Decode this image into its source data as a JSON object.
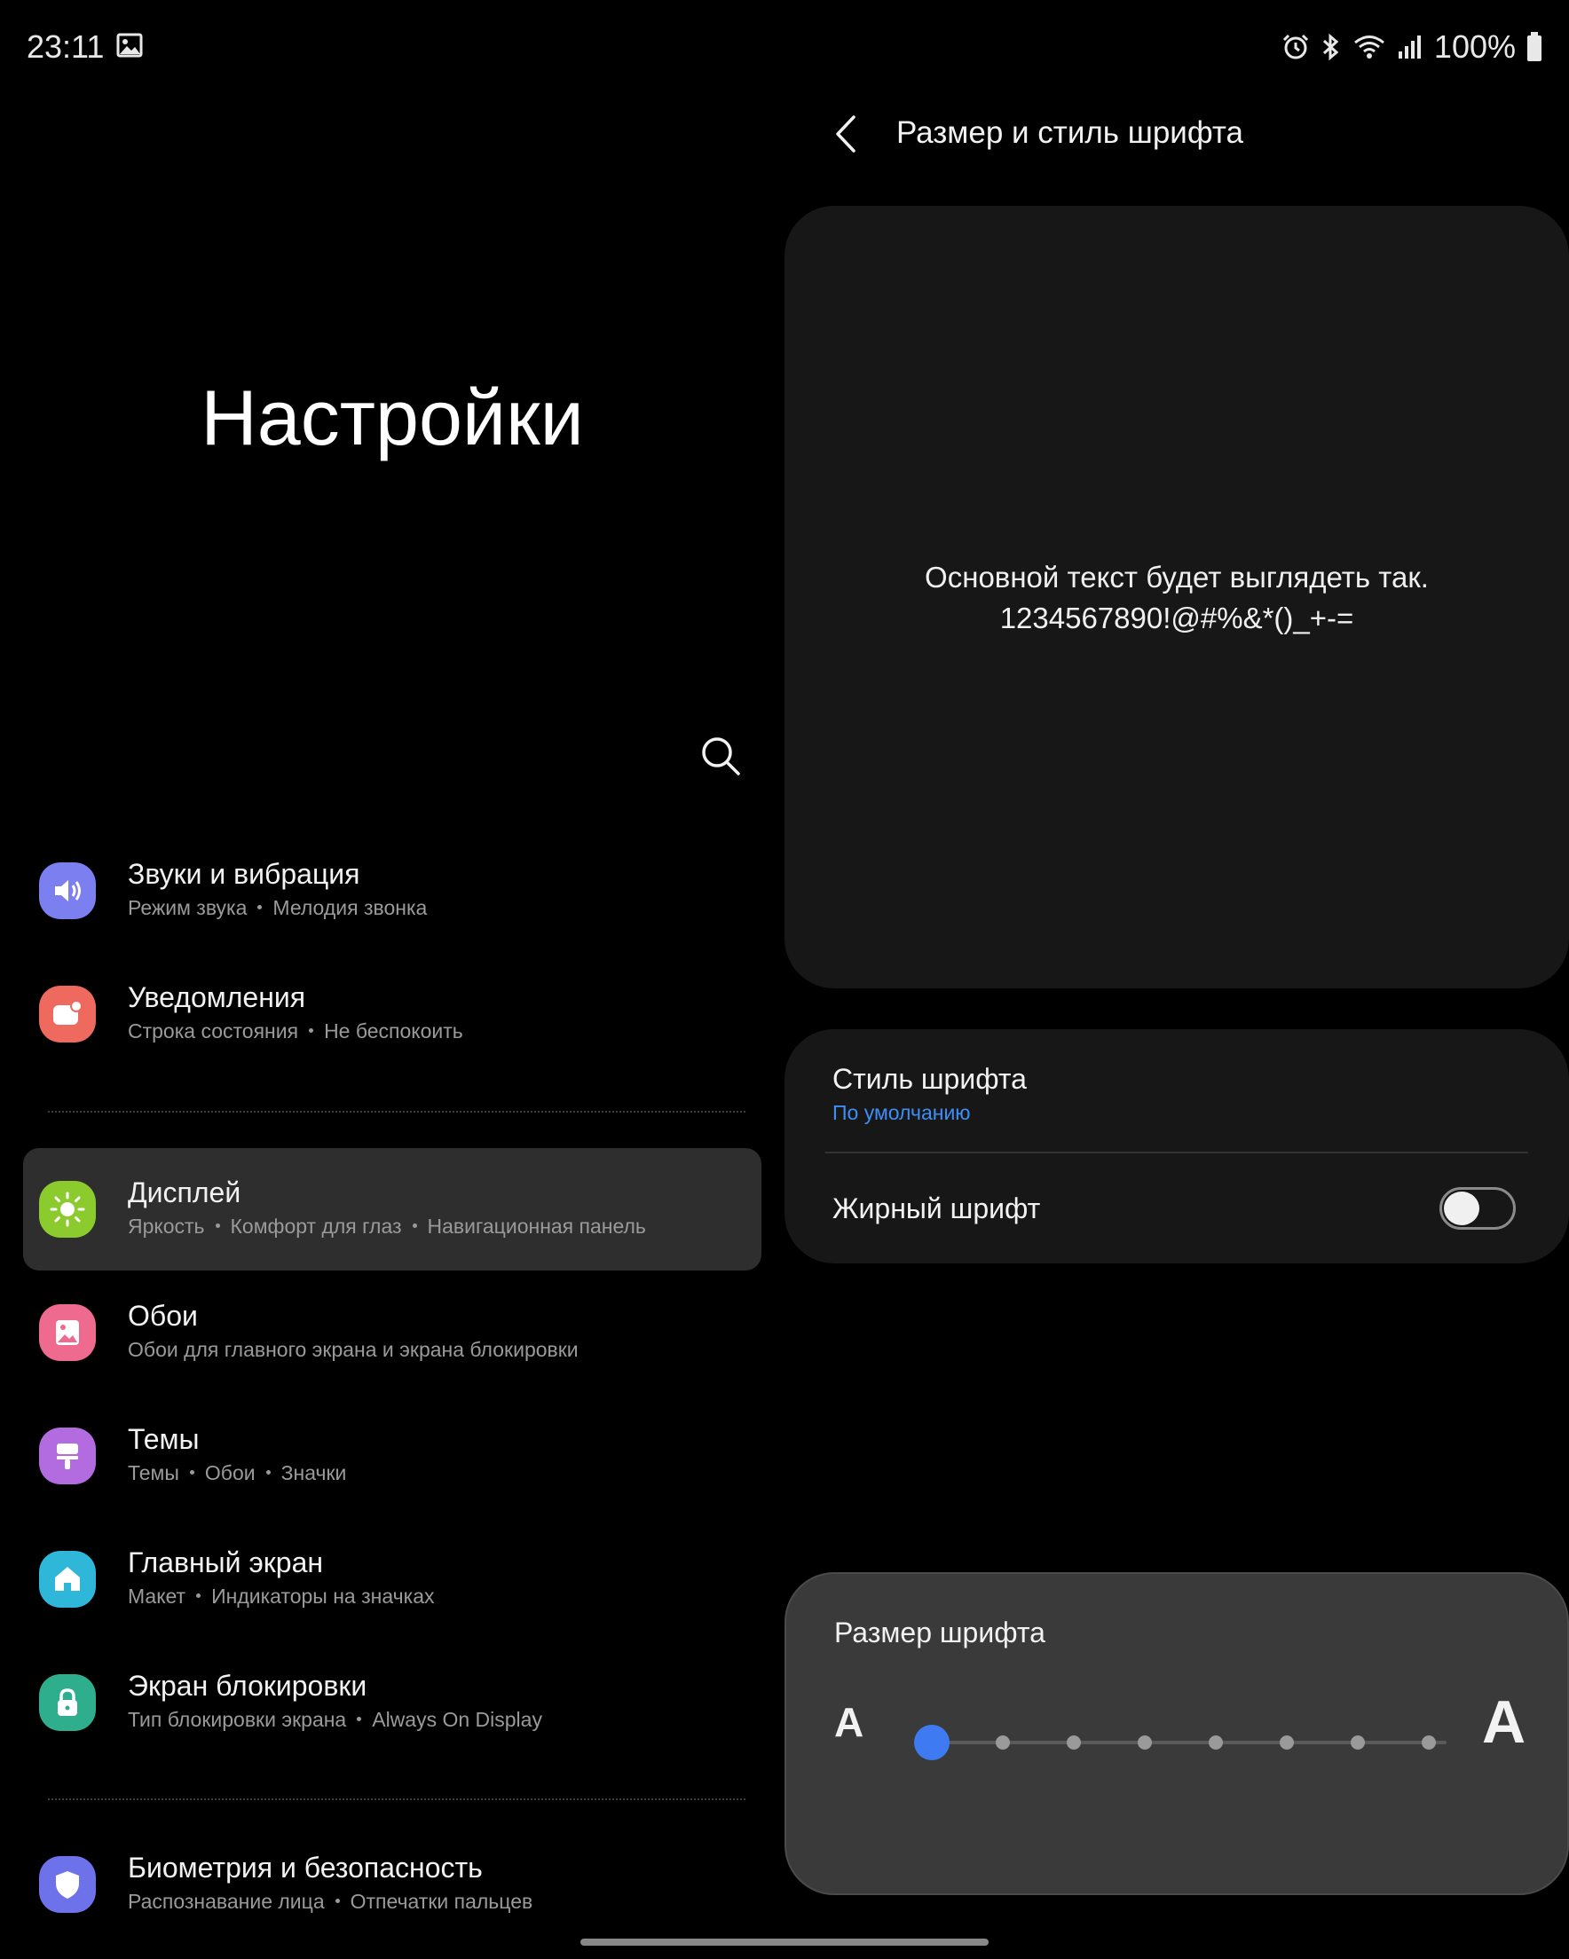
{
  "status": {
    "time": "23:11",
    "battery": "100%"
  },
  "left": {
    "title": "Настройки",
    "items": [
      {
        "title": "Звуки и вибрация",
        "subs": [
          "Режим звука",
          "Мелодия звонка"
        ],
        "icon": "speaker-icon",
        "color": "#7b7ff0"
      },
      {
        "title": "Уведомления",
        "subs": [
          "Строка состояния",
          "Не беспокоить"
        ],
        "icon": "notification-icon",
        "color": "#ee6a5e"
      },
      {
        "title": "Дисплей",
        "subs": [
          "Яркость",
          "Комфорт для глаз",
          "Навигационная панель"
        ],
        "icon": "sun-icon",
        "color": "#8ccb2d"
      },
      {
        "title": "Обои",
        "subs": [
          "Обои для главного экрана и экрана блокировки"
        ],
        "icon": "image-icon",
        "color": "#ee6b8f"
      },
      {
        "title": "Темы",
        "subs": [
          "Темы",
          "Обои",
          "Значки"
        ],
        "icon": "brush-icon",
        "color": "#b36be0"
      },
      {
        "title": "Главный экран",
        "subs": [
          "Макет",
          "Индикаторы на значках"
        ],
        "icon": "home-icon",
        "color": "#2eb7d9"
      },
      {
        "title": "Экран блокировки",
        "subs": [
          "Тип блокировки экрана",
          "Always On Display"
        ],
        "icon": "lock-icon",
        "color": "#2fae8e"
      },
      {
        "title": "Биометрия и безопасность",
        "subs": [
          "Распознавание лица",
          "Отпечатки пальцев"
        ],
        "icon": "shield-icon",
        "color": "#6e72ea"
      }
    ]
  },
  "right": {
    "title": "Размер и стиль шрифта",
    "preview_line1": "Основной текст будет выглядеть так.",
    "preview_line2": "1234567890!@#%&*()_+-=",
    "font_style_label": "Стиль шрифта",
    "font_style_value": "По умолчанию",
    "bold_label": "Жирный шрифт",
    "bold_enabled": false,
    "size_label": "Размер шрифта",
    "size_small_glyph": "A",
    "size_big_glyph": "A",
    "size_steps": 8,
    "size_value": 1
  },
  "colors": {
    "accent": "#3e8ef7",
    "slider_thumb": "#3e7bf2"
  }
}
